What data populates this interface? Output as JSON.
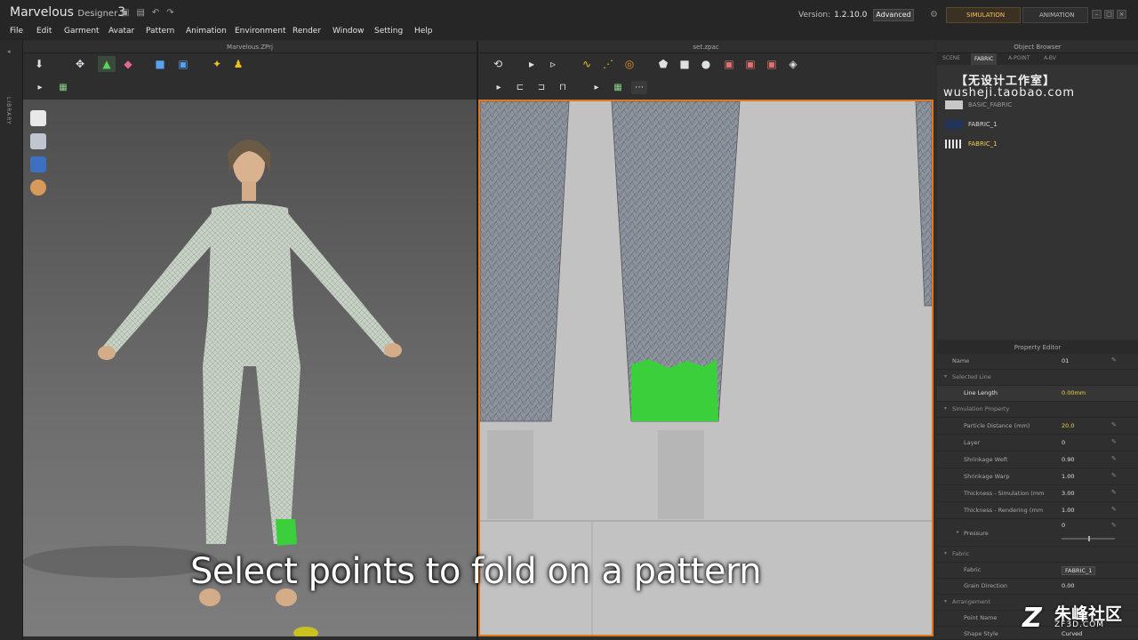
{
  "app": {
    "brand_main": "Marvelous",
    "brand_sub": "Designer",
    "brand_num": "3",
    "version_label": "Version:",
    "version_value": "1.2.10.0",
    "mode_label": "Advanced",
    "simulation_label": "SIMULATION",
    "animation_label": "ANIMATION"
  },
  "menu": [
    "File",
    "Edit",
    "Garment",
    "Avatar",
    "Pattern",
    "Animation",
    "Environment",
    "Render",
    "Window",
    "Setting",
    "Help"
  ],
  "library_label": "LIBRARY",
  "panels": {
    "view3d_title": "Marvelous.ZPrj",
    "view2d_title": "set.zpac",
    "object_browser_title": "Object Browser",
    "property_editor_title": "Property Editor"
  },
  "object_browser": {
    "tabs": [
      "SCENE",
      "FABRIC",
      "A-POINT",
      "A-BV"
    ],
    "active_tab": "FABRIC",
    "fabrics": [
      {
        "name": "BASIC_FABRIC",
        "color": "#c8c8c8"
      },
      {
        "name": "FABRIC_1",
        "color": "#23345a"
      },
      {
        "name": "FABRIC_1",
        "color": "#e6e6e6",
        "selected": true
      }
    ]
  },
  "watermark": {
    "line1": "【无设计工作室】",
    "line2": "wusheji.taobao.com"
  },
  "property_editor": {
    "rows": [
      {
        "label": "Name",
        "value": "01",
        "type": "field"
      },
      {
        "label": "Selected Line",
        "type": "section"
      },
      {
        "label": "Line Length",
        "value": "0.00mm",
        "type": "field",
        "highlight": true
      },
      {
        "label": "Simulation Property",
        "type": "section"
      },
      {
        "label": "Particle Distance (mm)",
        "value": "20.0",
        "type": "field",
        "highlight": true
      },
      {
        "label": "Layer",
        "value": "0",
        "type": "field"
      },
      {
        "label": "Shrinkage Weft",
        "value": "0.90",
        "type": "field"
      },
      {
        "label": "Shrinkage Warp",
        "value": "1.00",
        "type": "field"
      },
      {
        "label": "Thickness - Simulation (mm",
        "value": "3.00",
        "type": "field"
      },
      {
        "label": "Thickness - Rendering (mm",
        "value": "1.00",
        "type": "field"
      },
      {
        "label": "Pressure",
        "value": "0",
        "type": "slider"
      },
      {
        "label": "Fabric",
        "type": "section"
      },
      {
        "label": "Fabric",
        "value": "FABRIC_1",
        "type": "field"
      },
      {
        "label": "Grain Direction",
        "value": "0.00",
        "type": "field"
      },
      {
        "label": "Arrangement",
        "type": "section"
      },
      {
        "label": "Point Name",
        "value": "",
        "type": "field"
      },
      {
        "label": "Shape Style",
        "value": "Curved",
        "type": "field"
      }
    ]
  },
  "subtitle": "Select points to fold on a pattern",
  "logo": {
    "mark": "Z",
    "big": "朱峰社区",
    "small": "ZF3D.COM"
  }
}
